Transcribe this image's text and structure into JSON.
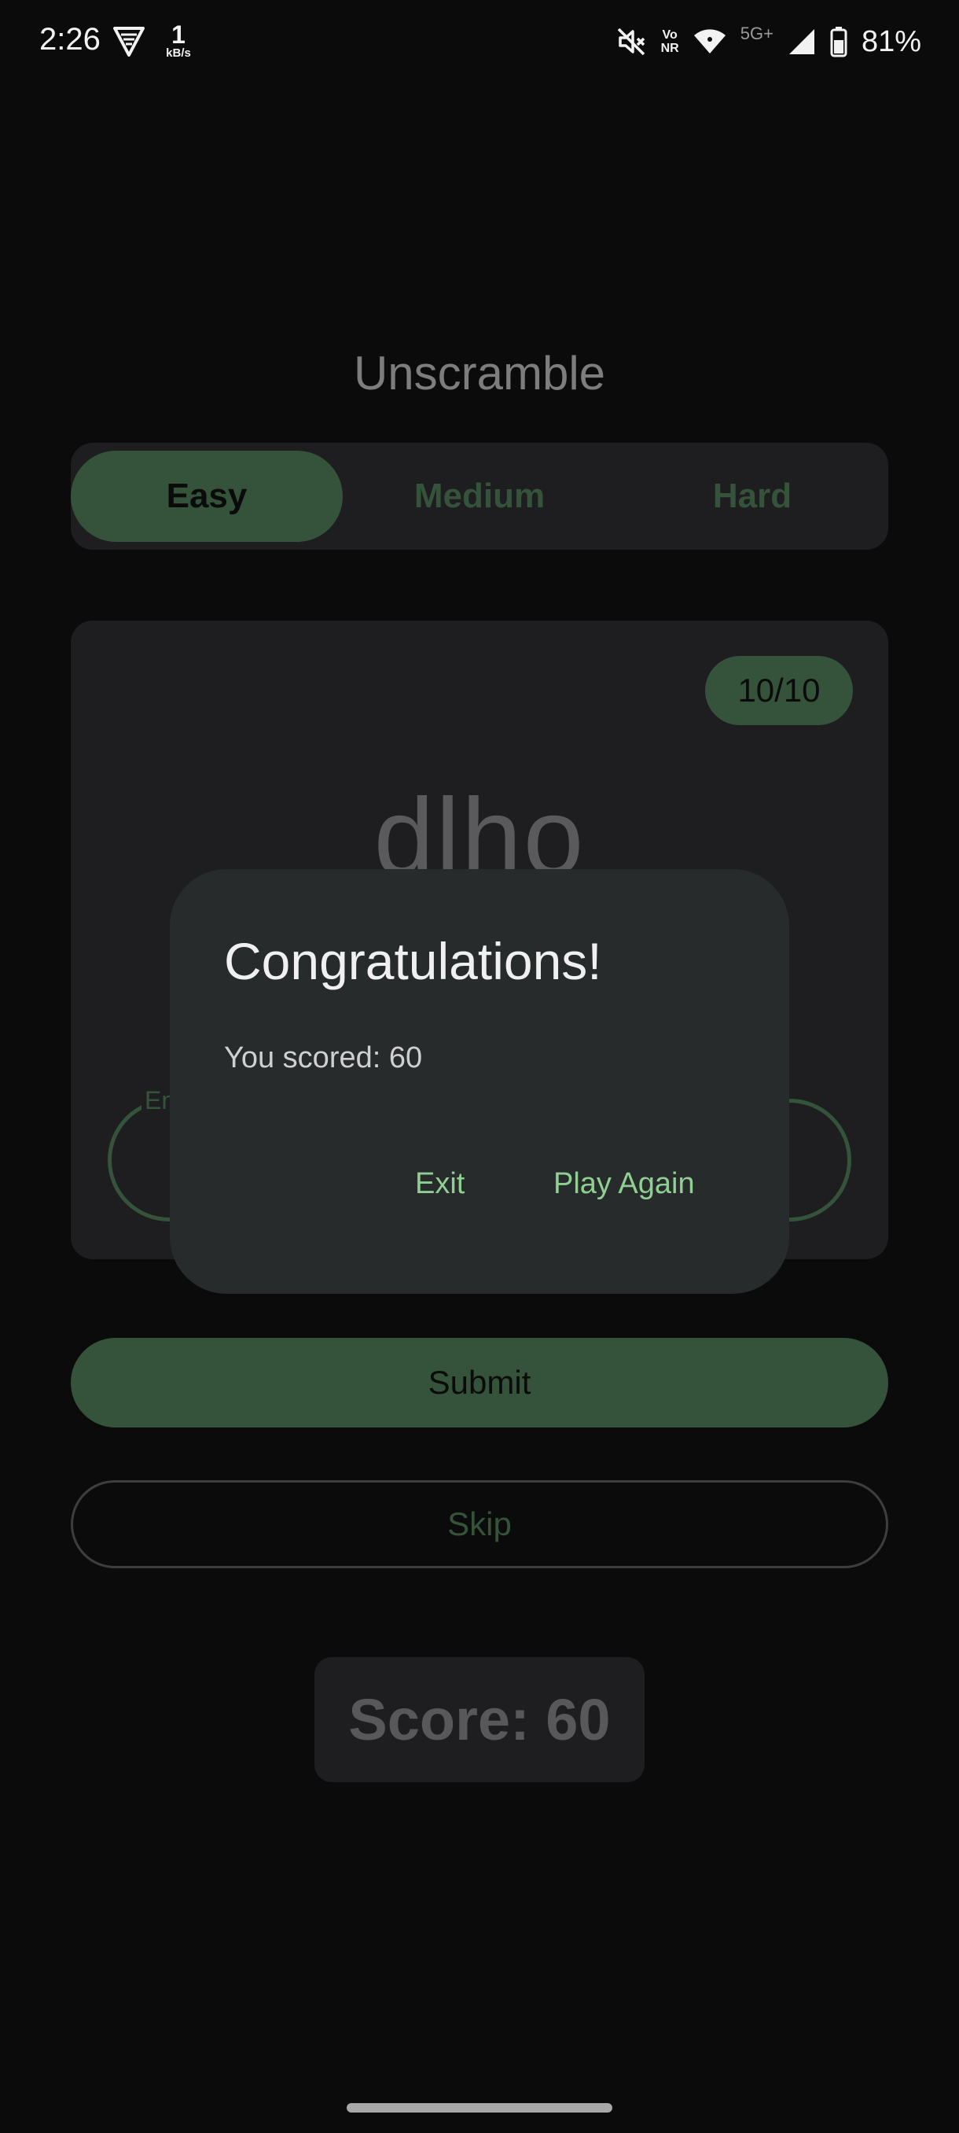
{
  "status_bar": {
    "time": "2:26",
    "speed_value": "1",
    "speed_unit": "kB/s",
    "volte_line1": "Vo",
    "volte_line2": "NR",
    "network": "5G+",
    "battery": "81%",
    "icons": [
      "vpn-shield-icon",
      "mute-icon",
      "volte-icon",
      "wifi-icon",
      "signal-icon",
      "battery-icon"
    ]
  },
  "app": {
    "title": "Unscramble",
    "difficulty": {
      "easy": "Easy",
      "medium": "Medium",
      "hard": "Hard",
      "selected": "Easy"
    },
    "card": {
      "counter": "10/10",
      "scrambled_word": "dlho",
      "answer_label": "En"
    },
    "submit_label": "Submit",
    "skip_label": "Skip",
    "score_text": "Score: 60"
  },
  "dialog": {
    "title": "Congratulations!",
    "message": "You scored: 60",
    "exit_label": "Exit",
    "play_again_label": "Play Again"
  },
  "colors": {
    "background": "#0b0b0c",
    "surface": "#1e1e21",
    "accent": "#35533a",
    "dialog": "#272b2b",
    "dialog_action": "#8fcf92"
  }
}
